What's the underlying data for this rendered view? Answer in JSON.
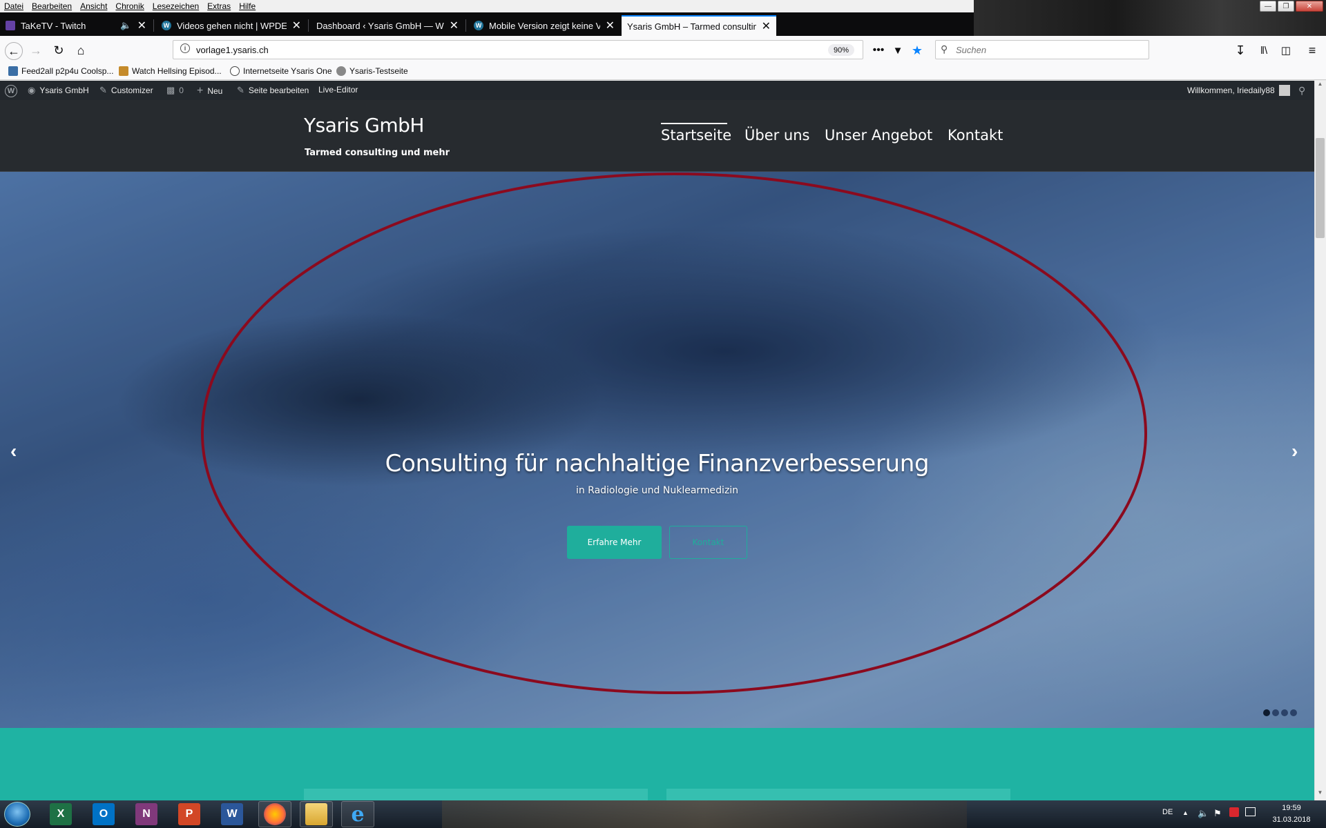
{
  "menubar": {
    "items": [
      "Datei",
      "Bearbeiten",
      "Ansicht",
      "Chronik",
      "Lesezeichen",
      "Extras",
      "Hilfe"
    ]
  },
  "tabs": [
    {
      "label": "TaKeTV - Twitch",
      "favicon_color": "#6441a5"
    },
    {
      "label": "Videos gehen nicht | WPDE.org",
      "favicon_color": "#21759b"
    },
    {
      "label": "Dashboard ‹ Ysaris GmbH — WordPress",
      "favicon_color": ""
    },
    {
      "label": "Mobile Version zeigt keine Videos",
      "favicon_color": "#21759b"
    },
    {
      "label": "Ysaris GmbH – Tarmed consulting und mehr",
      "favicon_color": ""
    }
  ],
  "navbar": {
    "url": "vorlage1.ysaris.ch",
    "zoom": "90%",
    "search_placeholder": "Suchen"
  },
  "bookmarks": [
    {
      "label": "Feed2all p2p4u Coolsp...",
      "color": "#3a6ea5"
    },
    {
      "label": "Watch Hellsing Episod...",
      "color": "#c58b2b"
    },
    {
      "label": "Internetseite Ysaris One",
      "color": "#444"
    },
    {
      "label": "Ysaris-Testseite",
      "color": "#666"
    }
  ],
  "wpadmin": {
    "site": "Ysaris GmbH",
    "customizer": "Customizer",
    "comments": "0",
    "new": "Neu",
    "edit_page": "Seite bearbeiten",
    "live_editor": "Live-Editor",
    "welcome": "Willkommen, Iriedaily88"
  },
  "site": {
    "title": "Ysaris GmbH",
    "tagline": "Tarmed consulting und mehr",
    "nav": [
      "Startseite",
      "Über uns",
      "Unser Angebot",
      "Kontakt"
    ]
  },
  "hero": {
    "title": "Consulting für nachhaltige Finanzverbesserung",
    "subtitle": "in Radiologie und Nuklearmedizin",
    "primary_button": "Erfahre Mehr",
    "secondary_button": "Kontakt",
    "slide_count": 4,
    "active_slide": 1,
    "annotation_color": "#8b0a1e"
  },
  "taskbar": {
    "language": "DE",
    "time": "19:59",
    "date": "31.03.2018",
    "apps": [
      "excel-icon",
      "outlook-icon",
      "onenote-icon",
      "powerpoint-icon",
      "word-icon",
      "firefox-icon",
      "explorer-icon",
      "internet-explorer-icon"
    ]
  },
  "colors": {
    "accent": "#1fae9c",
    "admin_bar": "#23282d",
    "header": "#272b2f"
  }
}
